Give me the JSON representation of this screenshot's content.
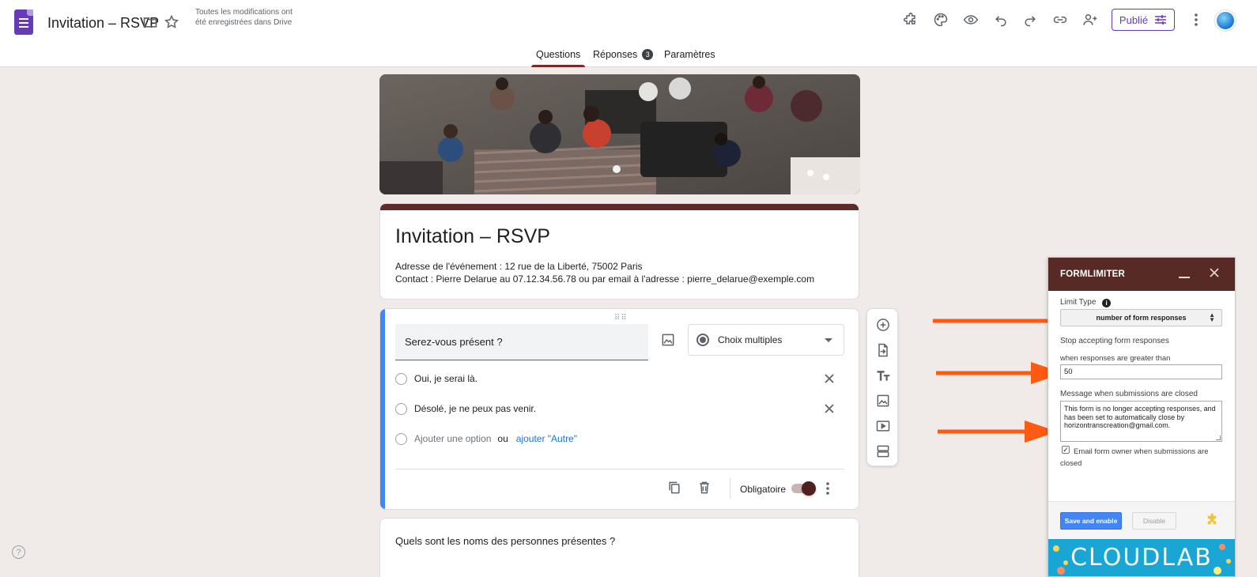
{
  "header": {
    "doc_title": "Invitation – RSVP",
    "save_status": "Toutes les modifications ont été enregistrées dans Drive",
    "publish_label": "Publié"
  },
  "tabs": [
    {
      "label": "Questions",
      "active": true
    },
    {
      "label": "Réponses",
      "badge": "3"
    },
    {
      "label": "Paramètres"
    }
  ],
  "form": {
    "title": "Invitation – RSVP",
    "desc_line1": "Adresse de l'événement : 12 rue de la Liberté, 75002 Paris",
    "desc_line2": "Contact : Pierre Delarue au 07.12.34.56.78 ou par email à l'adresse : pierre_delarue@exemple.com"
  },
  "question1": {
    "title": "Serez-vous présent ?",
    "type": "Choix multiples",
    "options": [
      "Oui, je serai là.",
      "Désolé, je ne peux pas venir."
    ],
    "add_option": "Ajouter une option",
    "add_or": "ou",
    "add_other": "ajouter \"Autre\"",
    "required_label": "Obligatoire"
  },
  "question2": {
    "title": "Quels sont les noms des personnes présentes ?"
  },
  "formlimiter": {
    "title": "FORMLIMITER",
    "limit_type_label": "Limit Type",
    "limit_type_value": "number of form responses",
    "stop_label": "Stop accepting form responses",
    "when_label": "when responses are greater than",
    "threshold": "50",
    "message_label": "Message when submissions are closed",
    "message": "This form is no longer accepting responses, and has been set to automatically close by horizontranscreation@gmail.com.",
    "email_owner_label": "Email form owner when submissions are closed",
    "email_owner_checked": true,
    "save_label": "Save and enable",
    "disable_label": "Disable",
    "brand": "CLOUDLAB"
  },
  "colors": {
    "theme": "#5e2a2a",
    "accent_blue": "#4285f4",
    "arrow": "#ff5a12"
  }
}
